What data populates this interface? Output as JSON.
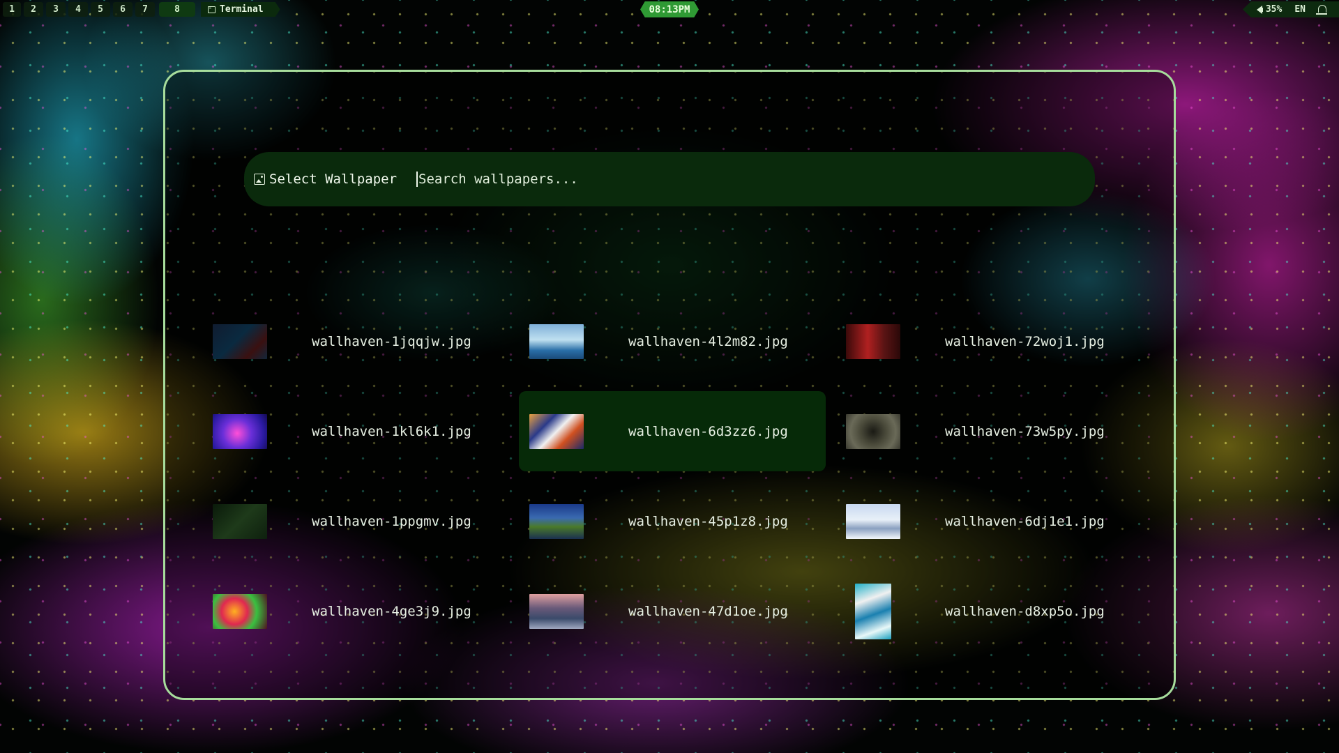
{
  "topbar": {
    "workspaces": [
      "1",
      "2",
      "3",
      "4",
      "5",
      "6",
      "7",
      "8"
    ],
    "active_workspace": "8",
    "window_title": "Terminal",
    "clock": "08:13PM",
    "volume": "35%",
    "language": "EN"
  },
  "launcher": {
    "prompt": "Select Wallpaper",
    "search_placeholder": "Search wallpapers...",
    "search_value": "",
    "selected_item": "wallhaven-6d3zz6.jpg",
    "items": [
      {
        "label": "wallhaven-1jqqjw.jpg",
        "thumb": "linear-gradient(135deg,#101c30 0%,#0a2a40 45%,#3a1010 75%,#12263a 100%)"
      },
      {
        "label": "wallhaven-4l2m82.jpg",
        "thumb": "linear-gradient(180deg,#7fb0d8 0%,#bfe0f0 45%,#2a6fa8 75%,#1a4a78 100%)"
      },
      {
        "label": "wallhaven-72woj1.jpg",
        "thumb": "linear-gradient(90deg,#3a0a0a 0%,#b02020 40%,#5a1414 70%,#2a0808 100%)"
      },
      {
        "label": "wallhaven-1kl6k1.jpg",
        "thumb": "radial-gradient(circle at 45% 55%,#ff4fd8 0%,#6a2fd8 40%,#2a1aa0 75%,#140a50 100%)"
      },
      {
        "label": "wallhaven-6d3zz6.jpg",
        "thumb": "linear-gradient(135deg,#e8a040 0%,#2a3a8a 30%,#f0f0f0 50%,#d05020 70%,#1a2a6a 100%)"
      },
      {
        "label": "wallhaven-73w5py.jpg",
        "thumb": "radial-gradient(circle at 50% 50%,#1a1a14 0%,#4a4a3a 40%,#6a6a58 70%,#3a3a30 100%)"
      },
      {
        "label": "wallhaven-1ppgmv.jpg",
        "thumb": "linear-gradient(135deg,#0a1a0a 0%,#1e3a1a 50%,#0e200e 100%)"
      },
      {
        "label": "wallhaven-45p1z8.jpg",
        "thumb": "linear-gradient(180deg,#1a3a8a 0%,#3a6ab0 40%,#4a7a2a 65%,#1a3050 100%)"
      },
      {
        "label": "wallhaven-6dj1e1.jpg",
        "thumb": "linear-gradient(180deg,#c8d8f0 0%,#e8f0f8 45%,#8aa0c0 70%,#f4f8fc 100%)"
      },
      {
        "label": "wallhaven-4ge3j9.jpg",
        "thumb": "radial-gradient(circle at 40% 50%,#ffb020 0%,#e02850 35%,#3ac040 60%,#501020 100%)"
      },
      {
        "label": "wallhaven-47d1oe.jpg",
        "thumb": "linear-gradient(180deg,#e0a0a0 0%,#6a5a7a 40%,#3a4a6a 70%,#a0a8c0 100%)"
      },
      {
        "label": "wallhaven-d8xp5o.jpg",
        "thumb": "linear-gradient(160deg,#20b0c8 0%,#f0f0f0 30%,#1a80b0 55%,#e8f8f8 80%,#1aa0c0 100%)",
        "tall": true
      }
    ]
  }
}
